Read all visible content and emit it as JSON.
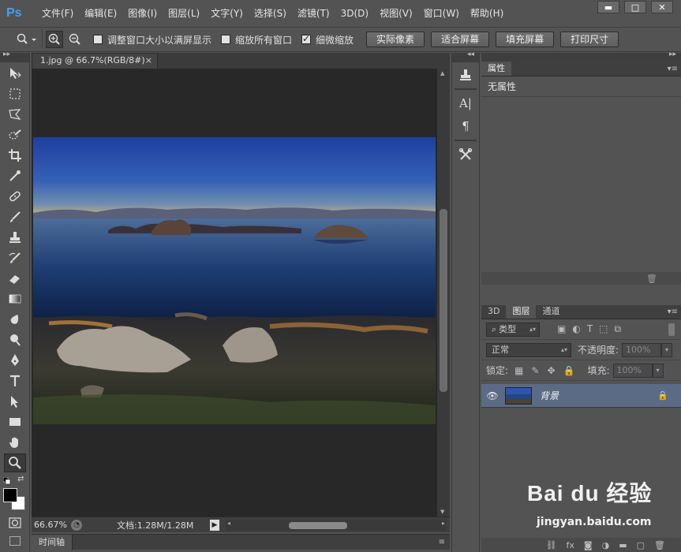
{
  "app": {
    "logo": "Ps"
  },
  "menu": [
    "文件(F)",
    "编辑(E)",
    "图像(I)",
    "图层(L)",
    "文字(Y)",
    "选择(S)",
    "滤镜(T)",
    "3D(D)",
    "视图(V)",
    "窗口(W)",
    "帮助(H)"
  ],
  "window_controls": {
    "minimize": "▬",
    "restore": "□",
    "close": "✕"
  },
  "options": {
    "resize_windows_label": "调整窗口大小以满屏显示",
    "resize_windows_checked": false,
    "zoom_all_label": "缩放所有窗口",
    "zoom_all_checked": false,
    "scrubby_zoom_label": "细微缩放",
    "scrubby_zoom_checked": true,
    "actual_pixels": "实际像素",
    "fit_screen": "适合屏幕",
    "fill_screen": "填充屏幕",
    "print_size": "打印尺寸"
  },
  "document": {
    "tab_title": "1.jpg @ 66.7%(RGB/8#)",
    "tab_close": "×",
    "zoom": "66.67%",
    "doc_info": "文档:1.28M/1.28M"
  },
  "timeline": {
    "tab": "时间轴"
  },
  "properties": {
    "tab": "属性",
    "body": "无属性"
  },
  "layers_panel": {
    "tabs": [
      "3D",
      "图层",
      "通道"
    ],
    "filter_kind": "类型",
    "blend_mode": "正常",
    "opacity_label": "不透明度:",
    "opacity_value": "100%",
    "lock_label": "锁定:",
    "fill_label": "填充:",
    "fill_value": "100%",
    "layers": [
      {
        "name": "背景",
        "visible": true,
        "locked": true
      }
    ]
  },
  "watermark": {
    "brand": "Bai du 经验",
    "url": "jingyan.baidu.com"
  },
  "colors": {
    "foreground": "#000000",
    "background": "#ffffff",
    "selected_layer": "#5b6b85",
    "ps_blue": "#3ea3f5"
  }
}
